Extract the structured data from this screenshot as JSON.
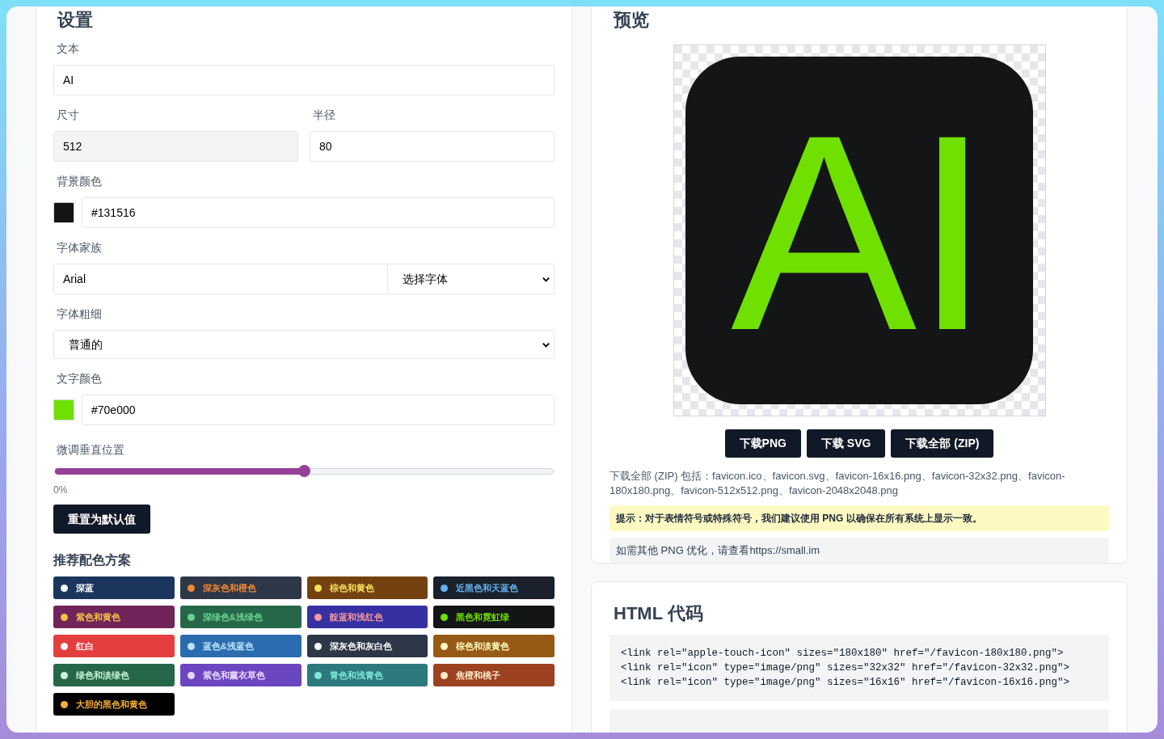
{
  "settings": {
    "title": "设置",
    "text_field": {
      "label": "文本",
      "value": "AI"
    },
    "size_field": {
      "label": "尺寸",
      "value": "512",
      "disabled": true
    },
    "radius_field": {
      "label": "半径",
      "value": "80",
      "disabled": false
    },
    "background_color": {
      "label": "背景颜色",
      "value": "#131516",
      "color": "#131516"
    },
    "font_family": {
      "label": "字体家族",
      "value": "Arial",
      "select": "选择字体"
    },
    "font_weight": {
      "label": "字体粗细",
      "value": "普通的"
    },
    "text_color": {
      "label": "文字颜色",
      "value": "#70e000",
      "color": "#70e000"
    },
    "vertical_offset": {
      "label": "微调垂直位置",
      "level": 0.5,
      "reading": "0%"
    },
    "reset_button": "重置为默认值",
    "schemes_title": "推荐配色方案",
    "schemes": [
      {
        "label": "深蓝",
        "color": "#1a365d",
        "dot": {
          "color": "#ffffff"
        }
      },
      {
        "label": "深灰色和橙色",
        "color": "#2d3748",
        "dot": {
          "color": "#ed8936"
        }
      },
      {
        "label": "棕色和黄色",
        "color": "#744210",
        "dot": {
          "color": "#f6e05e"
        }
      },
      {
        "label": "近黑色和天蓝色",
        "color": "#1a202c",
        "dot": {
          "color": "#63b3ed"
        }
      },
      {
        "label": "紫色和黄色",
        "color": "#702459",
        "dot": {
          "color": "#f6c244"
        }
      },
      {
        "label": "深绿色&浅绿色",
        "color": "#276749",
        "dot": {
          "color": "#68d391"
        }
      },
      {
        "label": "靛蓝和浅红色",
        "color": "#3730a3",
        "dot": {
          "color": "#f39a9a"
        }
      },
      {
        "label": "黑色和霓虹绿",
        "color": "#131516",
        "dot": {
          "color": "#70e000"
        }
      },
      {
        "label": "红白",
        "color": "#e53e3e",
        "dot": {
          "color": "#ffffff"
        }
      },
      {
        "label": "蓝色&浅蓝色",
        "color": "#2b6cb0",
        "dot": {
          "color": "#bee3f8"
        }
      },
      {
        "label": "深灰色和灰白色",
        "color": "#2d3748",
        "dot": {
          "color": "#f7fafc"
        }
      },
      {
        "label": "棕色和淡黄色",
        "color": "#975a16",
        "dot": {
          "color": "#fefcbf"
        }
      },
      {
        "label": "绿色和淡绿色",
        "color": "#276749",
        "dot": {
          "color": "#c6f6d5"
        }
      },
      {
        "label": "紫色和薰衣草色",
        "color": "#6b46c1",
        "dot": {
          "color": "#e9d8fd"
        }
      },
      {
        "label": "青色和浅青色",
        "color": "#2c7a7b",
        "dot": {
          "color": "#81e6d9"
        }
      },
      {
        "label": "焦橙和桃子",
        "color": "#9c4221",
        "dot": {
          "color": "#feebc8"
        }
      },
      {
        "label": "大胆的黑色和黄色",
        "color": "#000000",
        "dot": {
          "color": "#f6ad37"
        }
      }
    ]
  },
  "preview": {
    "title": "预览",
    "icon_text": "AI",
    "buttons": [
      "下载PNG",
      "下载 SVG",
      "下载全部 (ZIP)"
    ],
    "zip_note": "下载全部 (ZIP) 包括：favicon.ico、favicon.svg、favicon-16x16.png、favicon-32x32.png、favicon-180x180.png、favicon-512x512.png、favicon-2048x2048.png",
    "tip": "提示：对于表情符号或特殊符号，我们建议使用 PNG 以确保在所有系统上显示一致。",
    "optimize_note": "如需其他 PNG 优化，请查看https://small.im"
  },
  "html_code": {
    "title": "HTML 代码",
    "lines": [
      "<link rel=\"apple-touch-icon\" sizes=\"180x180\" href=\"/favicon-180x180.png\">",
      "<link rel=\"icon\" type=\"image/png\" sizes=\"32x32\" href=\"/favicon-32x32.png\">",
      "<link rel=\"icon\" type=\"image/png\" sizes=\"16x16\" href=\"/favicon-16x16.png\">"
    ]
  }
}
